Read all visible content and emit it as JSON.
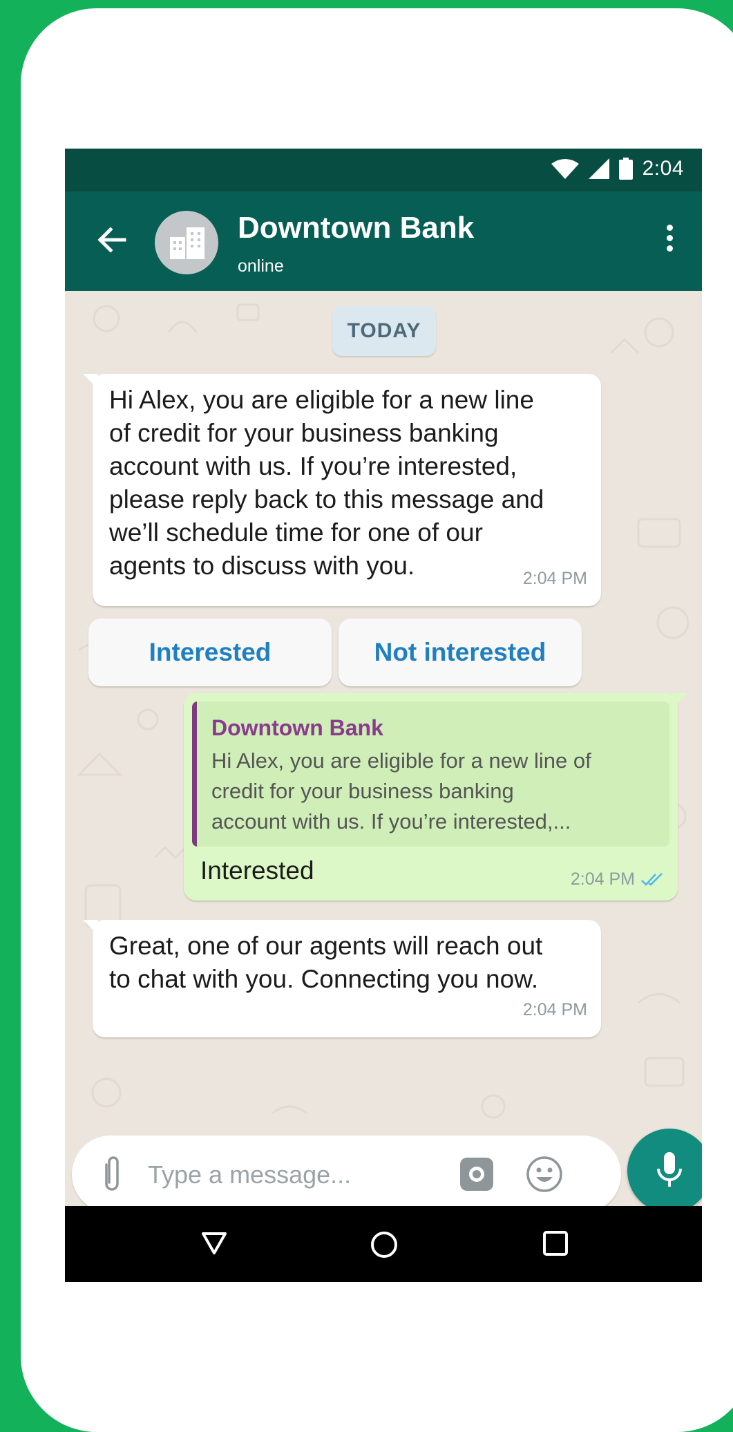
{
  "status_bar": {
    "time": "2:04"
  },
  "header": {
    "title": "Downtown Bank",
    "subtitle": "online"
  },
  "date_divider": "TODAY",
  "messages": [
    {
      "text": "Hi Alex, you are eligible for a new line\nof credit for your business banking\naccount with us. If you’re interested,\nplease reply back to this message and\nwe’ll schedule time for one of our\nagents to discuss with you.",
      "time": "2:04 PM"
    },
    {
      "quoted_name": "Downtown Bank",
      "quoted_text": "Hi Alex, you are eligible for a new line of\ncredit for your business banking\naccount with us. If you’re interested,...",
      "text": "Interested",
      "time": "2:04 PM"
    },
    {
      "text": "Great, one of our agents will reach out\nto chat with you. Connecting you now.",
      "time": "2:04 PM"
    }
  ],
  "quick_replies": [
    "Interested",
    "Not interested"
  ],
  "input": {
    "placeholder": "Type a message..."
  },
  "colors": {
    "background": "#13b25a",
    "header": "#075e54",
    "status_bar": "#074d42",
    "outgoing_bubble": "#dcf8c6",
    "quick_reply_text": "#1f7fc1",
    "mic_button": "#128c7e"
  },
  "icons": [
    "back-arrow-icon",
    "bank-building-icon",
    "more-vert-icon",
    "wifi-icon",
    "signal-icon",
    "battery-icon",
    "paperclip-icon",
    "camera-icon",
    "emoji-icon",
    "microphone-icon",
    "double-check-icon",
    "nav-back-icon",
    "nav-home-icon",
    "nav-recents-icon"
  ]
}
